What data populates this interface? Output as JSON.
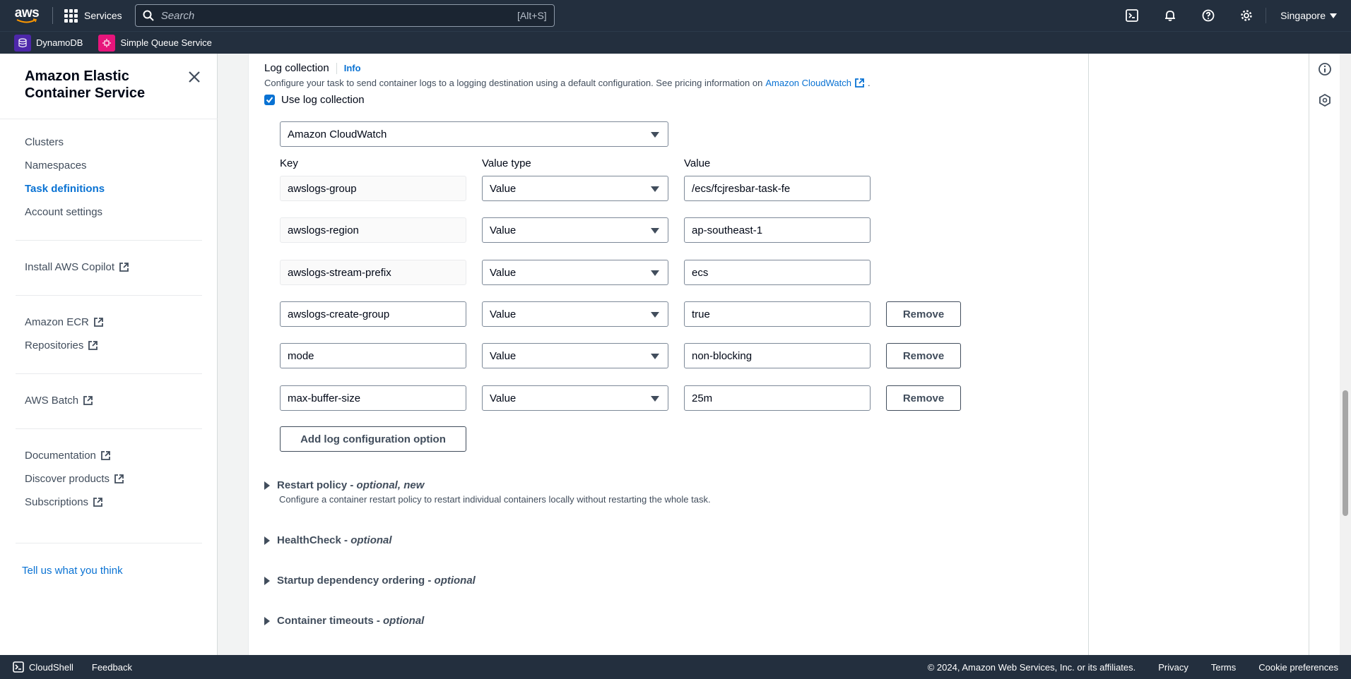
{
  "topnav": {
    "logo_text": "aws",
    "services_label": "Services",
    "search_placeholder": "Search",
    "search_shortcut": "[Alt+S]",
    "region": "Singapore"
  },
  "favorites": [
    {
      "label": "DynamoDB",
      "color": "#4d27aa"
    },
    {
      "label": "Simple Queue Service",
      "color": "#e7157b"
    }
  ],
  "sidebar": {
    "title": "Amazon Elastic Container Service",
    "items": [
      {
        "label": "Clusters"
      },
      {
        "label": "Namespaces"
      },
      {
        "label": "Task definitions",
        "active": true
      },
      {
        "label": "Account settings"
      }
    ],
    "external_links": [
      {
        "label": "Install AWS Copilot"
      },
      {
        "label": "Amazon ECR"
      },
      {
        "label": "Repositories"
      },
      {
        "label": "AWS Batch"
      },
      {
        "label": "Documentation"
      },
      {
        "label": "Discover products"
      },
      {
        "label": "Subscriptions"
      }
    ],
    "feedback_link": "Tell us what you think"
  },
  "log_collection": {
    "title": "Log collection",
    "info": "Info",
    "description": "Configure your task to send container logs to a logging destination using a default configuration. See pricing information on",
    "pricing_link": "Amazon CloudWatch",
    "checkbox_label": "Use log collection",
    "destination": "Amazon CloudWatch",
    "columns": {
      "key": "Key",
      "value_type": "Value type",
      "value": "Value"
    },
    "options": [
      {
        "key": "awslogs-group",
        "value_type": "Value",
        "value": "/ecs/fcjresbar-task-fe"
      },
      {
        "key": "awslogs-region",
        "value_type": "Value",
        "value": "ap-southeast-1"
      },
      {
        "key": "awslogs-stream-prefix",
        "value_type": "Value",
        "value": "ecs"
      },
      {
        "key": "awslogs-create-group",
        "value_type": "Value",
        "value": "true",
        "remove": "Remove"
      },
      {
        "key": "mode",
        "value_type": "Value",
        "value": "non-blocking",
        "remove": "Remove"
      },
      {
        "key": "max-buffer-size",
        "value_type": "Value",
        "value": "25m",
        "remove": "Remove"
      }
    ],
    "add_button": "Add log configuration option"
  },
  "sections": [
    {
      "title": "Restart policy - ",
      "suffix": "optional, new",
      "description": "Configure a container restart policy to restart individual containers locally without restarting the whole task."
    },
    {
      "title": "HealthCheck - ",
      "suffix": "optional"
    },
    {
      "title": "Startup dependency ordering - ",
      "suffix": "optional"
    },
    {
      "title": "Container timeouts - ",
      "suffix": "optional"
    }
  ],
  "footer": {
    "cloudshell": "CloudShell",
    "feedback": "Feedback",
    "copyright": "© 2024, Amazon Web Services, Inc. or its affiliates.",
    "privacy": "Privacy",
    "terms": "Terms",
    "cookies": "Cookie preferences"
  },
  "colors": {
    "nav_bg": "#232f3e",
    "link_blue": "#0972d3",
    "text_dark": "#000716",
    "text_secondary": "#414d5c"
  }
}
